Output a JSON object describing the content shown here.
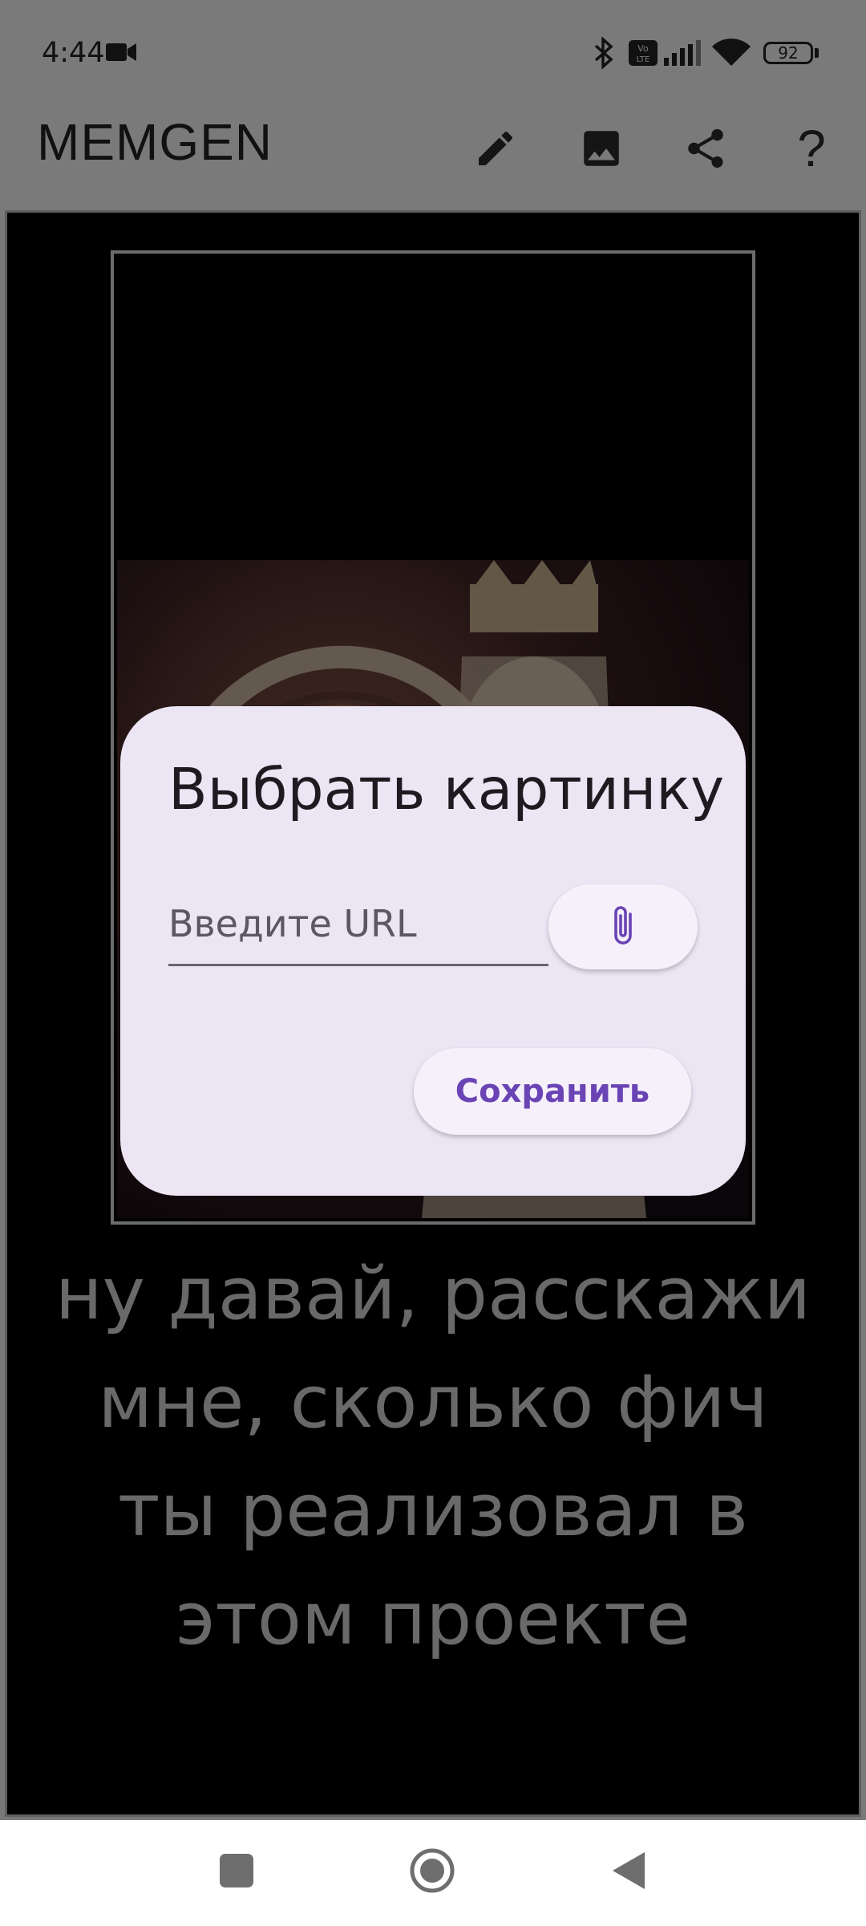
{
  "status_bar": {
    "time": "4:44",
    "battery": "92",
    "icons": [
      "video-camera-icon",
      "bluetooth-icon",
      "volte-icon",
      "signal-icon",
      "wifi-icon",
      "battery-icon"
    ]
  },
  "app_bar": {
    "title": "MEMGEN",
    "actions": [
      "edit-icon",
      "image-icon",
      "share-icon",
      "help-icon"
    ],
    "help_glyph": "?"
  },
  "meme": {
    "bottom_text": "ну давай, расскажи мне, сколько фич ты реализовал в этом проекте"
  },
  "dialog": {
    "title": "Выбрать картинку",
    "url_placeholder": "Введите URL",
    "url_value": "",
    "attach_icon": "paperclip-icon",
    "save_label": "Сохранить"
  },
  "nav_bar": {
    "buttons": [
      "recents-icon",
      "home-icon",
      "back-icon"
    ]
  },
  "colors": {
    "accent": "#6a44b4",
    "dialog_bg": "#ece5f4",
    "button_bg": "#f6f0fa",
    "canvas_bg": "#000000"
  }
}
